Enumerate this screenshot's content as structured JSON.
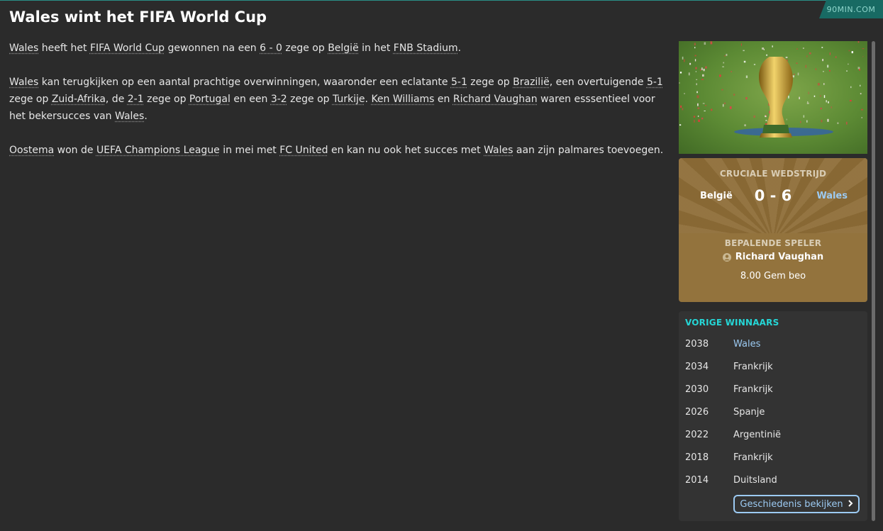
{
  "brand": "90MIN.COM",
  "page_title": "Wales wint het FIFA World Cup",
  "article": {
    "p1": [
      {
        "t": "Wales",
        "link": true
      },
      {
        "t": " heeft het ",
        "link": false
      },
      {
        "t": "FIFA World Cup",
        "link": true
      },
      {
        "t": " gewonnen na een ",
        "link": false
      },
      {
        "t": "6 - 0",
        "link": true
      },
      {
        "t": " zege op ",
        "link": false
      },
      {
        "t": "België",
        "link": true
      },
      {
        "t": " in het ",
        "link": false
      },
      {
        "t": "FNB Stadium",
        "link": true
      },
      {
        "t": ".",
        "link": false
      }
    ],
    "p2": [
      {
        "t": "Wales",
        "link": true
      },
      {
        "t": " kan terugkijken op een aantal prachtige overwinningen, waaronder een eclatante ",
        "link": false
      },
      {
        "t": "5-1",
        "link": true
      },
      {
        "t": " zege op ",
        "link": false
      },
      {
        "t": "Brazilië",
        "link": true
      },
      {
        "t": ", een overtuigende ",
        "link": false
      },
      {
        "t": "5-1",
        "link": true
      },
      {
        "t": " zege op ",
        "link": false
      },
      {
        "t": "Zuid-Afrika",
        "link": true
      },
      {
        "t": ", de ",
        "link": false
      },
      {
        "t": "2-1",
        "link": true
      },
      {
        "t": " zege op ",
        "link": false
      },
      {
        "t": "Portugal",
        "link": true
      },
      {
        "t": " en een ",
        "link": false
      },
      {
        "t": "3-2",
        "link": true
      },
      {
        "t": " zege op ",
        "link": false
      },
      {
        "t": "Turkije",
        "link": true
      },
      {
        "t": ". ",
        "link": false
      },
      {
        "t": "Ken Williams",
        "link": true
      },
      {
        "t": " en ",
        "link": false
      },
      {
        "t": "Richard Vaughan",
        "link": true
      },
      {
        "t": " waren esssentieel voor het bekersucces van ",
        "link": false
      },
      {
        "t": "Wales",
        "link": true
      },
      {
        "t": ".",
        "link": false
      }
    ],
    "p3": [
      {
        "t": "Oostema",
        "link": true
      },
      {
        "t": " won de ",
        "link": false
      },
      {
        "t": "UEFA Champions League",
        "link": true
      },
      {
        "t": " in mei met ",
        "link": false
      },
      {
        "t": "FC United",
        "link": true
      },
      {
        "t": " en kan nu ook het succes met ",
        "link": false
      },
      {
        "t": "Wales",
        "link": true
      },
      {
        "t": " aan zijn palmares toevoegen.",
        "link": false
      }
    ]
  },
  "key_match": {
    "label": "CRUCIALE WEDSTRIJD",
    "home": "België",
    "score": "0 - 6",
    "away": "Wales"
  },
  "key_player": {
    "label": "BEPALENDE SPELER",
    "name": "Richard Vaughan",
    "rating": "8.00 Gem beo"
  },
  "previous_winners": {
    "title": "VORIGE WINNAARS",
    "rows": [
      {
        "year": "2038",
        "team": "Wales",
        "highlight": true
      },
      {
        "year": "2034",
        "team": "Frankrijk",
        "highlight": false
      },
      {
        "year": "2030",
        "team": "Frankrijk",
        "highlight": false
      },
      {
        "year": "2026",
        "team": "Spanje",
        "highlight": false
      },
      {
        "year": "2022",
        "team": "Argentinië",
        "highlight": false
      },
      {
        "year": "2018",
        "team": "Frankrijk",
        "highlight": false
      },
      {
        "year": "2014",
        "team": "Duitsland",
        "highlight": false
      }
    ],
    "button_label": "Geschiedenis bekijken"
  },
  "colors": {
    "background": "#2b2b2b",
    "accent_cyan": "#25d6d6",
    "link_blue": "#9ccaf2",
    "gold_card": "#93733d"
  },
  "icons": [
    "trophy-image",
    "person-icon",
    "chevron-right-icon"
  ]
}
